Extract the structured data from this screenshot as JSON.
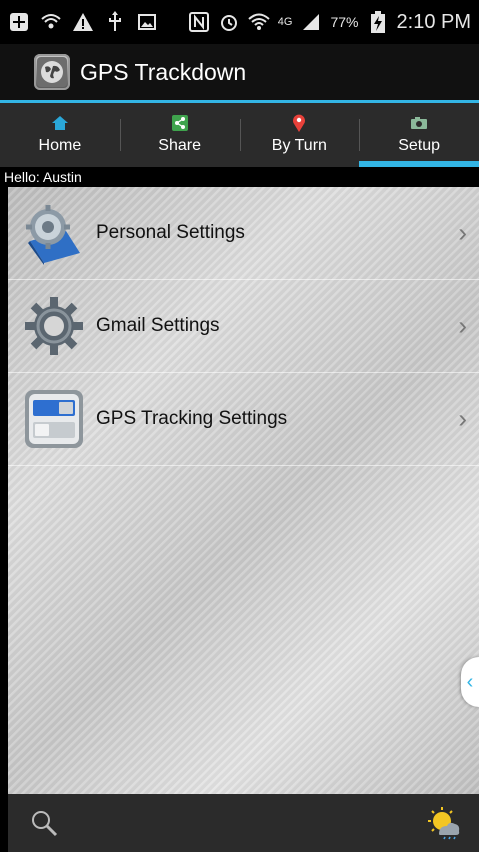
{
  "status_bar": {
    "battery": "77%",
    "network": "4G",
    "time": "2:10 PM"
  },
  "app": {
    "title": "GPS Trackdown"
  },
  "tabs": [
    {
      "label": "Home",
      "icon": "home-icon"
    },
    {
      "label": "Share",
      "icon": "share-icon"
    },
    {
      "label": "By Turn",
      "icon": "map-pin-icon"
    },
    {
      "label": "Setup",
      "icon": "camera-icon",
      "active": true
    }
  ],
  "greeting": "Hello: Austin",
  "settings": [
    {
      "label": "Personal Settings",
      "icon": "personal-settings-icon"
    },
    {
      "label": "Gmail Settings",
      "icon": "gear-icon"
    },
    {
      "label": "GPS Tracking Settings",
      "icon": "toggle-settings-icon"
    }
  ],
  "colors": {
    "accent": "#33b5e5",
    "actionbar": "#111111",
    "tabbar": "#2b2b2b"
  }
}
